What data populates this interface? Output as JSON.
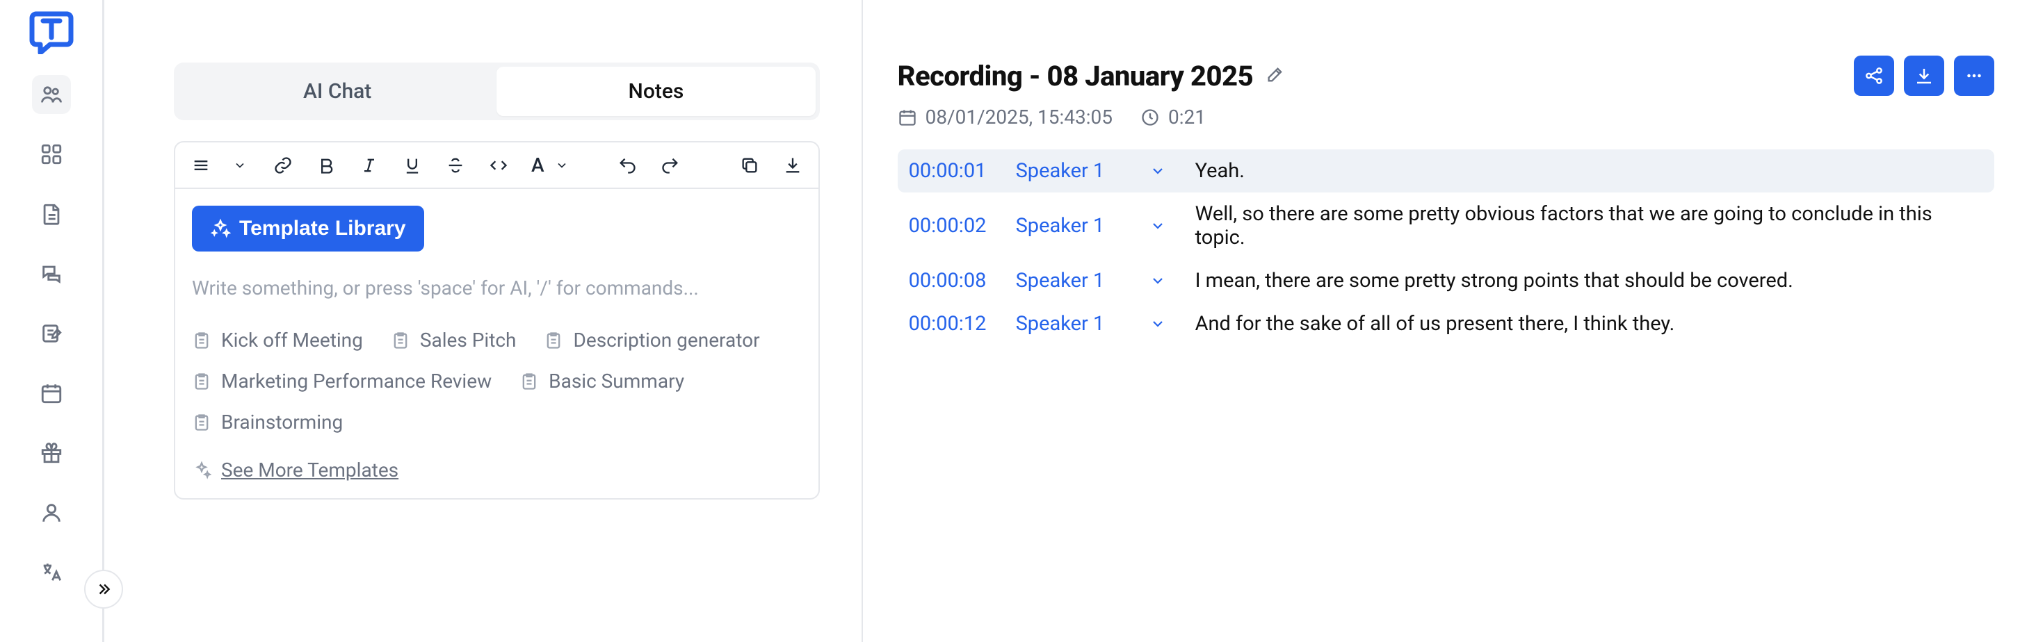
{
  "sidebar": {
    "expand_label": "expand"
  },
  "tabs": {
    "ai_chat": "AI Chat",
    "notes": "Notes"
  },
  "editor": {
    "template_library_btn": "Template Library",
    "placeholder": "Write something, or press 'space' for AI, '/' for commands...",
    "templates": [
      "Kick off Meeting",
      "Sales Pitch",
      "Description generator",
      "Marketing Performance Review",
      "Basic Summary",
      "Brainstorming"
    ],
    "see_more": "See More Templates"
  },
  "recording": {
    "title": "Recording - 08 January 2025",
    "date": "08/01/2025, 15:43:05",
    "duration": "0:21"
  },
  "transcript": [
    {
      "time": "00:00:01",
      "speaker": "Speaker 1",
      "text": "Yeah.",
      "active": true
    },
    {
      "time": "00:00:02",
      "speaker": "Speaker 1",
      "text": "Well, so there are some pretty obvious factors that we are going to conclude in this topic.",
      "active": false
    },
    {
      "time": "00:00:08",
      "speaker": "Speaker 1",
      "text": "I mean, there are some pretty strong points that should be covered.",
      "active": false
    },
    {
      "time": "00:00:12",
      "speaker": "Speaker 1",
      "text": "And for the sake of all of us present there, I think they.",
      "active": false
    }
  ]
}
